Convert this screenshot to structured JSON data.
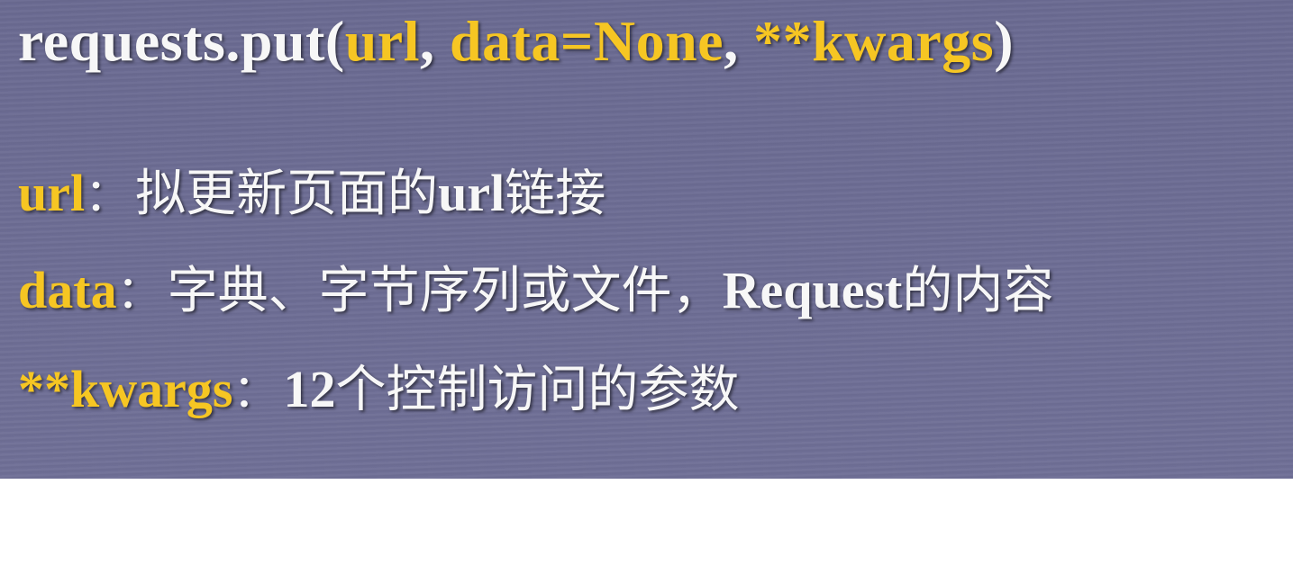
{
  "signature": {
    "func": "requests.put(",
    "arg1": "url",
    "sep1": ", ",
    "arg2": "data=None",
    "sep2": ", ",
    "arg3": "**kwargs",
    "close": ")"
  },
  "params": [
    {
      "name": "url",
      "colon": "：",
      "desc_parts": [
        "拟更新页面的",
        "url",
        "链接"
      ]
    },
    {
      "name": "data",
      "colon": "：",
      "desc_parts": [
        "字典、字节序列或文件，",
        "Request",
        "的内容"
      ]
    },
    {
      "name": "**kwargs",
      "colon": "：",
      "desc_parts": [
        "12",
        "个控制访问的参数"
      ]
    }
  ],
  "colors": {
    "background": "#6c6c93",
    "keyword": "#f6c623",
    "text": "#f7f7f7"
  }
}
